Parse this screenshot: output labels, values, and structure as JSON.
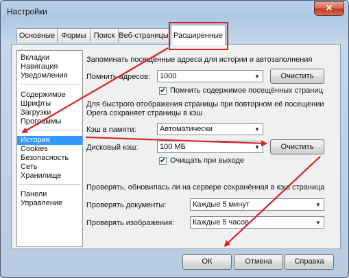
{
  "window": {
    "title": "Настройки",
    "close_glyph": "✕"
  },
  "tabs": [
    {
      "label": "Основные"
    },
    {
      "label": "Формы"
    },
    {
      "label": "Поиск"
    },
    {
      "label": "Веб-страницы"
    },
    {
      "label": "Расширенные"
    }
  ],
  "sidebar": {
    "items": [
      "Вкладки",
      "Навигация",
      "Уведомления",
      "Содержимое",
      "Шрифты",
      "Загрузки",
      "Программы",
      "История",
      "Cookies",
      "Безопасность",
      "Сеть",
      "Хранилище",
      "Панели",
      "Управление"
    ],
    "selected": "История"
  },
  "history": {
    "heading": "Запоминать посещённые адреса для истории и автозаполнения",
    "remember_label": "Помнить адресов:",
    "remember_value": "1000",
    "clear_label": "Очистить",
    "remember_content_label": "Помнить содержимое посещённых страниц",
    "remember_content_checked": true
  },
  "cache": {
    "heading1": "Для быстрого отображения страницы при повторном её посещении",
    "heading2": "Opera сохраняет страницы в кэш",
    "memory_label": "Кэш в памяти:",
    "memory_value": "Автоматически",
    "disk_label": "Дисковый кэш:",
    "disk_value": "100 МБ",
    "clear_label": "Очистить",
    "clear_on_exit_label": "Очищать при выходе",
    "clear_on_exit_checked": true
  },
  "check": {
    "heading": "Проверять, обновилась ли на сервере сохранённая в кэш страница",
    "documents_label": "Проверять документы:",
    "documents_value": "Каждые 5 минут",
    "images_label": "Проверять изображения:",
    "images_value": "Каждые 5 часов"
  },
  "footer": {
    "ok": "ОК",
    "cancel": "Отмена",
    "help": "Справка"
  },
  "colors": {
    "annotation": "#d42222",
    "selection": "#3399ff"
  }
}
